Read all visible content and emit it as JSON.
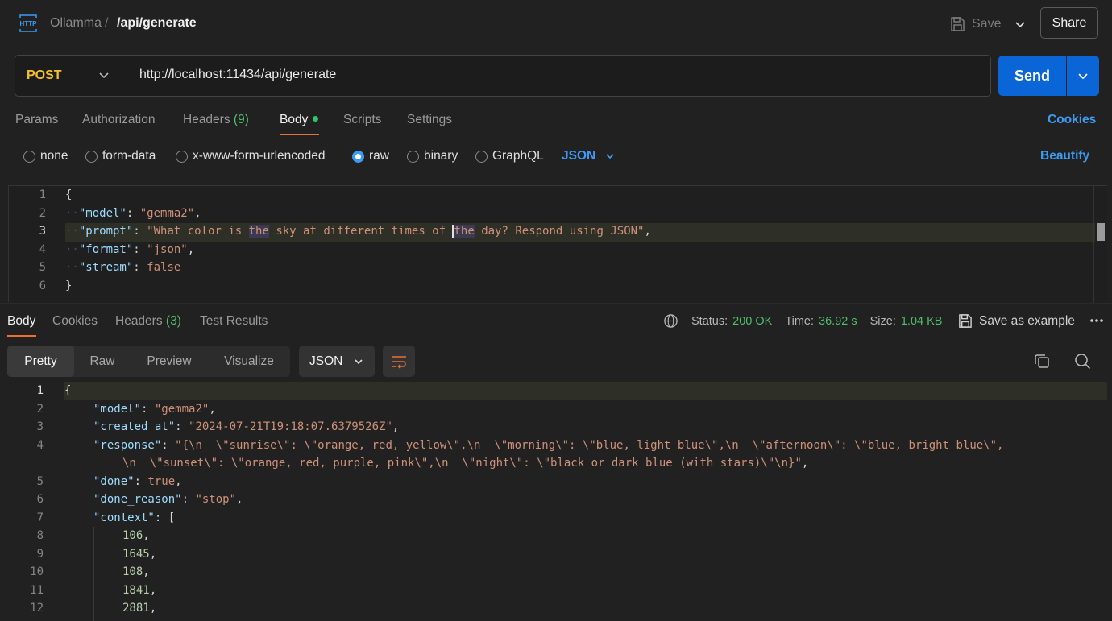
{
  "header": {
    "icon_text": "HTTP",
    "breadcrumb_parent": "Ollamma",
    "breadcrumb_sep": "/",
    "breadcrumb_current": "/api/generate",
    "save_label": "Save",
    "share_label": "Share"
  },
  "request": {
    "method": "POST",
    "url": "http://localhost:11434/api/generate",
    "send_label": "Send"
  },
  "request_tabs": {
    "params": "Params",
    "authorization": "Authorization",
    "headers": "Headers",
    "headers_count": "(9)",
    "body": "Body",
    "scripts": "Scripts",
    "settings": "Settings",
    "cookies": "Cookies"
  },
  "body_types": {
    "none": "none",
    "form_data": "form-data",
    "urlencoded": "x-www-form-urlencoded",
    "raw": "raw",
    "binary": "binary",
    "graphql": "GraphQL",
    "language": "JSON",
    "beautify": "Beautify"
  },
  "request_body": {
    "line_numbers": [
      "1",
      "2",
      "3",
      "4",
      "5",
      "6"
    ],
    "open": "{",
    "close": "}",
    "model_key": "\"model\"",
    "model_val": "\"gemma2\"",
    "prompt_key": "\"prompt\"",
    "prompt_a": "\"What color is ",
    "prompt_the1": "the",
    "prompt_b": " sky at different times of ",
    "prompt_the2": "the",
    "prompt_c": " day? Respond using JSON\"",
    "format_key": "\"format\"",
    "format_val": "\"json\"",
    "stream_key": "\"stream\"",
    "stream_val": "false"
  },
  "response_tabs": {
    "body": "Body",
    "cookies": "Cookies",
    "headers": "Headers",
    "headers_count": "(3)",
    "test_results": "Test Results"
  },
  "response_meta": {
    "status_label": "Status:",
    "status_value": "200 OK",
    "time_label": "Time:",
    "time_value": "36.92 s",
    "size_label": "Size:",
    "size_value": "1.04 KB",
    "save_example": "Save as example"
  },
  "view_modes": {
    "pretty": "Pretty",
    "raw": "Raw",
    "preview": "Preview",
    "visualize": "Visualize",
    "format": "JSON"
  },
  "response_body": {
    "line_numbers": [
      "1",
      "2",
      "3",
      "4",
      "5",
      "6",
      "7",
      "8",
      "9",
      "10",
      "11",
      "12"
    ],
    "open": "{",
    "model_key": "\"model\"",
    "model_val": "\"gemma2\"",
    "created_key": "\"created_at\"",
    "created_val": "\"2024-07-21T19:18:07.6379526Z\"",
    "response_key": "\"response\"",
    "response_val_1": "\"{\\n  \\\"sunrise\\\": \\\"orange, red, yellow\\\",\\n  \\\"morning\\\": \\\"blue, light blue\\\",\\n  \\\"afternoon\\\": \\\"blue, bright blue\\\",",
    "response_val_2": "\\n  \\\"sunset\\\": \\\"orange, red, purple, pink\\\",\\n  \\\"night\\\": \\\"black or dark blue (with stars)\\\"\\n}\"",
    "done_key": "\"done\"",
    "done_val": "true",
    "reason_key": "\"done_reason\"",
    "reason_val": "\"stop\"",
    "context_key": "\"context\"",
    "context_open": "[",
    "context_values": [
      "106",
      "1645",
      "108",
      "1841",
      "2881"
    ]
  }
}
